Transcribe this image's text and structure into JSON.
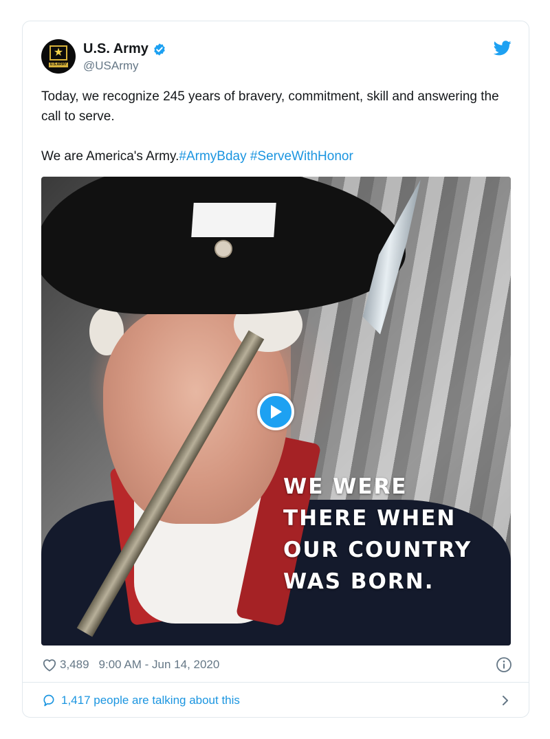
{
  "author": {
    "display_name": "U.S. Army",
    "handle": "@USArmy",
    "avatar_label": "U.S.ARMY"
  },
  "tweet": {
    "line1": "Today, we recognize 245 years of bravery, commitment, skill and answering the call to serve.",
    "line2_prefix": "We are America's Army.",
    "hashtag1": "#ArmyBday",
    "hashtag2": "#ServeWithHonor"
  },
  "media": {
    "caption_lines": [
      "WE WERE",
      "THERE WHEN",
      "OUR COUNTRY",
      "WAS BORN."
    ],
    "play_icon": "play-icon"
  },
  "meta": {
    "likes": "3,489",
    "timestamp": "9:00 AM - Jun 14, 2020"
  },
  "footer": {
    "talking": "1,417 people are talking about this"
  },
  "colors": {
    "accent": "#1da1f2",
    "link": "#1b95e0",
    "muted": "#657786",
    "border": "#e1e8ed"
  }
}
